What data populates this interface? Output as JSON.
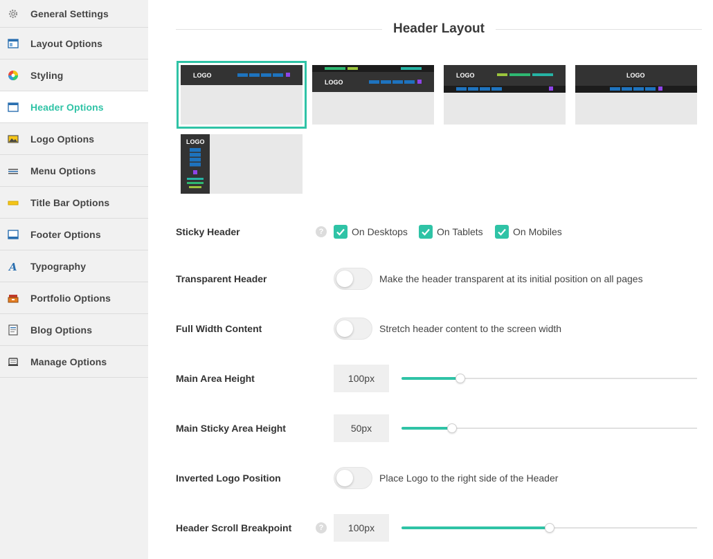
{
  "sidebar": {
    "items": [
      {
        "label": "General Settings",
        "icon": "gear-icon",
        "active": false
      },
      {
        "label": "Layout Options",
        "icon": "layout-icon",
        "active": false
      },
      {
        "label": "Styling",
        "icon": "color-wheel-icon",
        "active": false
      },
      {
        "label": "Header Options",
        "icon": "header-icon",
        "active": true
      },
      {
        "label": "Logo Options",
        "icon": "image-icon",
        "active": false
      },
      {
        "label": "Menu Options",
        "icon": "menu-icon",
        "active": false
      },
      {
        "label": "Title Bar Options",
        "icon": "title-bar-icon",
        "active": false
      },
      {
        "label": "Footer Options",
        "icon": "footer-icon",
        "active": false
      },
      {
        "label": "Typography",
        "icon": "typography-icon",
        "active": false
      },
      {
        "label": "Portfolio Options",
        "icon": "portfolio-icon",
        "active": false
      },
      {
        "label": "Blog Options",
        "icon": "blog-icon",
        "active": false
      },
      {
        "label": "Manage Options",
        "icon": "manage-icon",
        "active": false
      }
    ]
  },
  "section": {
    "title": "Header Layout"
  },
  "layouts": {
    "logo_text": "LOGO",
    "selected_index": 0,
    "colors": {
      "accent": "#2fc3a6",
      "dark": "#333333",
      "blue": "#1e73be",
      "purple": "#8e44e8",
      "green": "#2eb872",
      "lime": "#9bc53d",
      "teal": "#26b3a4"
    }
  },
  "options": {
    "sticky_header": {
      "label": "Sticky Header",
      "help": "?",
      "checkboxes": [
        {
          "label": "On Desktops",
          "checked": true
        },
        {
          "label": "On Tablets",
          "checked": true
        },
        {
          "label": "On Mobiles",
          "checked": true
        }
      ]
    },
    "transparent_header": {
      "label": "Transparent Header",
      "on": false,
      "description": "Make the header transparent at its initial position on all pages"
    },
    "full_width_content": {
      "label": "Full Width Content",
      "on": false,
      "description": "Stretch header content to the screen width"
    },
    "main_area_height": {
      "label": "Main Area Height",
      "value": "100px",
      "fill": 0.2
    },
    "main_sticky_area_height": {
      "label": "Main Sticky Area Height",
      "value": "50px",
      "fill": 0.17
    },
    "inverted_logo_position": {
      "label": "Inverted Logo Position",
      "on": false,
      "description": "Place Logo to the right side of the Header"
    },
    "header_scroll_breakpoint": {
      "label": "Header Scroll Breakpoint",
      "help": "?",
      "value": "100px",
      "fill": 0.5
    }
  },
  "accent_color": "#2fc3a6"
}
